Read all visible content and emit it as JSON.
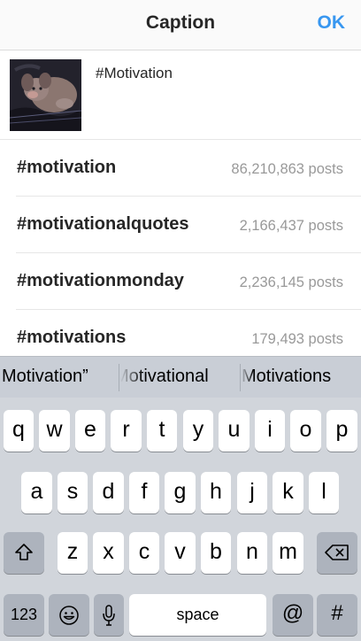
{
  "header": {
    "title": "Caption",
    "ok_label": "OK"
  },
  "composer": {
    "caption": "#Motivation"
  },
  "suggestions": [
    {
      "tag": "#motivation",
      "count": "86,210,863 posts"
    },
    {
      "tag": "#motivationalquotes",
      "count": "2,166,437 posts"
    },
    {
      "tag": "#motivationmonday",
      "count": "2,236,145 posts"
    },
    {
      "tag": "#motivations",
      "count": "179,493 posts"
    }
  ],
  "predictive": [
    "Motivation”",
    "Motivational",
    "Motivations"
  ],
  "keyboard": {
    "row1": [
      "q",
      "w",
      "e",
      "r",
      "t",
      "y",
      "u",
      "i",
      "o",
      "p"
    ],
    "row2": [
      "a",
      "s",
      "d",
      "f",
      "g",
      "h",
      "j",
      "k",
      "l"
    ],
    "row3": [
      "z",
      "x",
      "c",
      "v",
      "b",
      "n",
      "m"
    ],
    "numbers_label": "123",
    "space_label": "space",
    "at_label": "@",
    "hash_label": "#",
    "shift_icon": "shift-icon",
    "delete_icon": "backspace-icon",
    "emoji_icon": "emoji-icon",
    "mic_icon": "microphone-icon"
  },
  "colors": {
    "accent": "#3897f0",
    "keyboard_bg": "#d1d5db",
    "predictive_bg": "#c9ced6"
  }
}
